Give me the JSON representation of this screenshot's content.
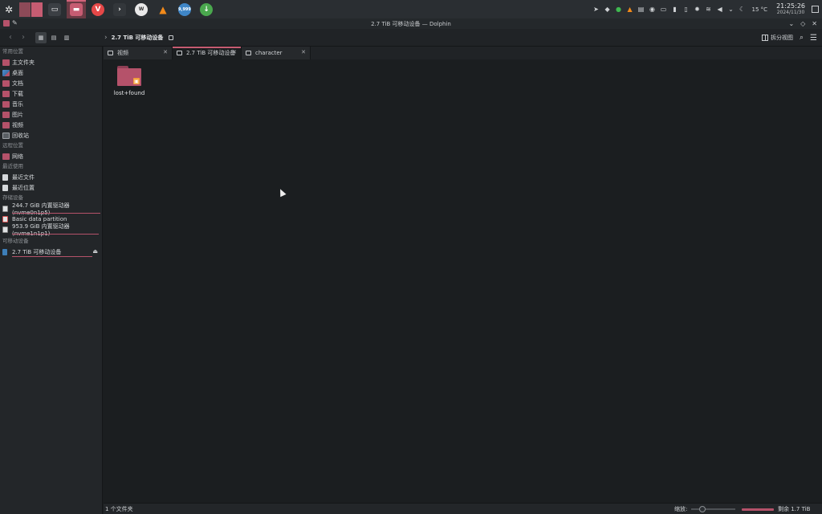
{
  "colors": {
    "accent": "#c65c72",
    "folder": "#b5526a",
    "background": "#1b1e20"
  },
  "panel": {
    "tasks": [
      {
        "name": "terminal",
        "icon": "terminal-icon"
      },
      {
        "name": "file-manager",
        "icon": "folder-icon",
        "active": true
      },
      {
        "name": "vivaldi",
        "icon": "vivaldi-icon"
      },
      {
        "name": "konsole",
        "icon": "console-icon"
      },
      {
        "name": "wps",
        "icon": "wps-icon"
      },
      {
        "name": "vlc",
        "icon": "vlc-icon"
      },
      {
        "name": "ktorrent",
        "icon": "download-icon",
        "badge": "9,999"
      },
      {
        "name": "updater",
        "icon": "update-icon"
      }
    ],
    "tray": {
      "temperature": "15 °C",
      "time": "21:25:26",
      "date": "2024/11/30"
    }
  },
  "window": {
    "title": "2.7 TiB 可移动设备 — Dolphin"
  },
  "toolbar": {
    "breadcrumb": "2.7 TiB 可移动设备",
    "split_label": "拆分视图"
  },
  "sidebar": {
    "sections": [
      {
        "title": "常用位置",
        "items": [
          {
            "label": "主文件夹",
            "icon": "home-folder-icon"
          },
          {
            "label": "桌面",
            "icon": "desktop-folder-icon"
          },
          {
            "label": "文档",
            "icon": "documents-folder-icon"
          },
          {
            "label": "下载",
            "icon": "downloads-folder-icon"
          },
          {
            "label": "音乐",
            "icon": "music-folder-icon"
          },
          {
            "label": "图片",
            "icon": "pictures-folder-icon"
          },
          {
            "label": "视频",
            "icon": "videos-folder-icon"
          },
          {
            "label": "回收站",
            "icon": "trash-icon"
          }
        ]
      },
      {
        "title": "远程位置",
        "items": [
          {
            "label": "网络",
            "icon": "network-folder-icon"
          }
        ]
      },
      {
        "title": "最近使用",
        "items": [
          {
            "label": "最近文件",
            "icon": "recent-files-icon"
          },
          {
            "label": "最近位置",
            "icon": "recent-locations-icon"
          }
        ]
      },
      {
        "title": "存储设备",
        "items": [
          {
            "label": "244.7 GiB 内置驱动器 (nvme0n1p5)",
            "icon": "drive-icon",
            "usage": 0.8
          },
          {
            "label": "Basic data partition",
            "icon": "drive-icon"
          },
          {
            "label": "953.9 GiB 内置驱动器 (nvme1n1p1)",
            "icon": "drive-icon",
            "usage": 0.9
          }
        ]
      },
      {
        "title": "可移动设备",
        "items": [
          {
            "label": "2.7 TiB 可移动设备",
            "icon": "usb-drive-icon",
            "usage": 0.8,
            "ejectable": true
          }
        ]
      }
    ]
  },
  "tabs": [
    {
      "label": "视频",
      "icon": "video-tab-icon"
    },
    {
      "label": "2.7 TiB 可移动设备",
      "icon": "folder-tab-icon",
      "active": true
    },
    {
      "label": "character",
      "icon": "folder-tab-icon"
    }
  ],
  "files": [
    {
      "name": "lost+found",
      "icon": "locked-folder-icon"
    }
  ],
  "status": {
    "count": "1 个文件夹",
    "zoom_label": "缩放:",
    "free_space": "剩余 1.7 TiB",
    "free_fraction": 0.37
  }
}
